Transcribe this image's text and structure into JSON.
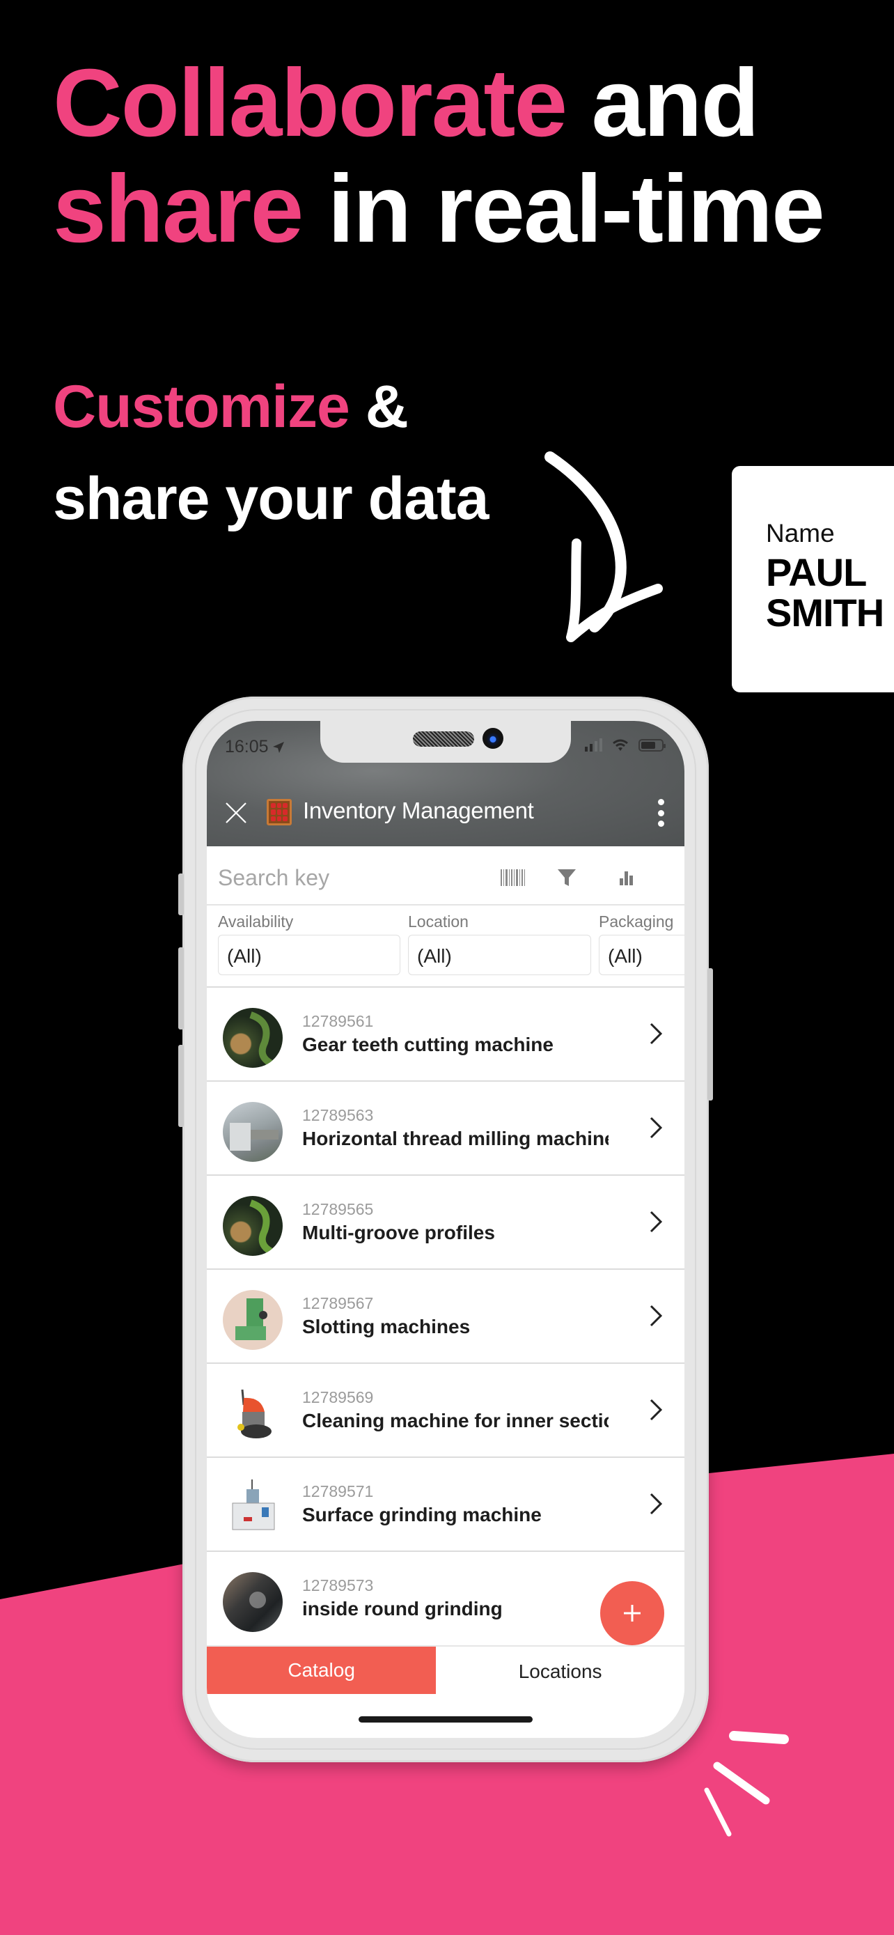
{
  "colors": {
    "accent_pink": "#f0437f",
    "background": "#000000",
    "app_accent": "#f25e52"
  },
  "headline": {
    "line1_accent": "Collaborate",
    "line1_rest": " and",
    "line2_accent": "share",
    "line2_rest": " in real-time"
  },
  "subhead": {
    "line1_accent": "Customize",
    "line1_rest": " &",
    "line2": "share your data"
  },
  "name_card": {
    "label": "Name",
    "first_name": "PAUL",
    "last_name": "SMITH"
  },
  "phone": {
    "status_bar": {
      "time": "16:05",
      "icons": [
        "location-arrow-icon",
        "cellular-signal-icon",
        "wifi-icon",
        "battery-icon"
      ]
    },
    "app_bar": {
      "title": "Inventory Management",
      "left_icon": "close-icon",
      "app_icon": "abacus-icon",
      "right_icon": "more-vertical-icon"
    },
    "search": {
      "placeholder": "Search key",
      "value": "",
      "tools": [
        "barcode-icon",
        "filter-icon",
        "bar-chart-icon"
      ]
    },
    "filters": [
      {
        "label": "Availability",
        "value": "(All)"
      },
      {
        "label": "Location",
        "value": "(All)"
      },
      {
        "label": "Packaging",
        "value": "(All)"
      }
    ],
    "items": [
      {
        "code": "12789561",
        "name": "Gear teeth cutting machine",
        "thumb": "gear"
      },
      {
        "code": "12789563",
        "name": "Horizontal thread milling machine",
        "thumb": "lathe"
      },
      {
        "code": "12789565",
        "name": "Multi-groove profiles",
        "thumb": "gear"
      },
      {
        "code": "12789567",
        "name": "Slotting machines",
        "thumb": "green"
      },
      {
        "code": "12789569",
        "name": "Cleaning machine for inner section",
        "thumb": "cleaner"
      },
      {
        "code": "12789571",
        "name": "Surface grinding machine",
        "thumb": "grinder"
      },
      {
        "code": "12789573",
        "name": "inside round grinding",
        "thumb": "dark"
      }
    ],
    "fab_label": "+",
    "tabs": [
      {
        "label": "Catalog",
        "active": true
      },
      {
        "label": "Locations",
        "active": false
      }
    ]
  }
}
